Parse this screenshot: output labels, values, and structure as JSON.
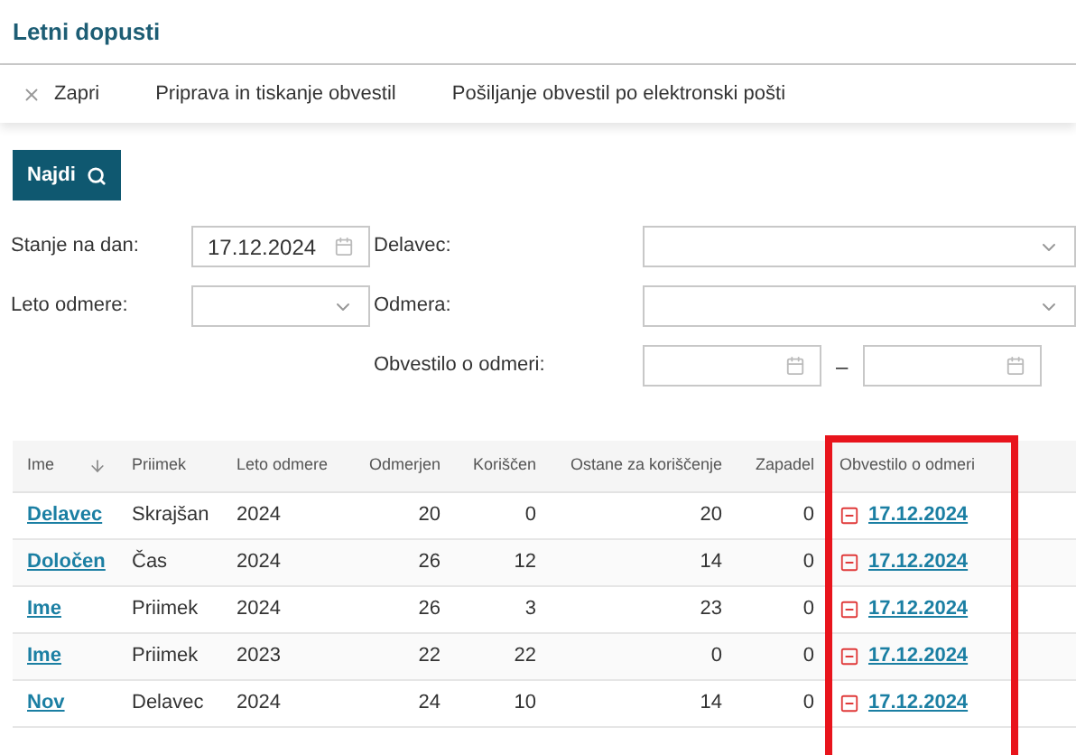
{
  "window": {
    "title": "Letni dopusti"
  },
  "toolbar": [
    {
      "kind": "close",
      "label": "Zapri"
    },
    {
      "kind": "text",
      "label": "Priprava in tiskanje obvestil"
    },
    {
      "kind": "text",
      "label": "Pošiljanje obvestil po elektronski pošti"
    }
  ],
  "search_button": {
    "label": "Najdi"
  },
  "filters_left": [
    {
      "label": "Stanje na dan:",
      "kind": "date",
      "value": "17.12.2024"
    },
    {
      "label": "Leto odmere:",
      "kind": "select"
    }
  ],
  "filters_right": [
    {
      "label": "Delavec:",
      "kind": "select"
    },
    {
      "label": "Odmera:",
      "kind": "select"
    },
    {
      "label": "Obvestilo o odmeri:",
      "kind": "date_range",
      "separator": "–"
    }
  ],
  "table": {
    "columns": [
      {
        "label": "Ime",
        "sorted": true
      },
      {
        "label": "Priimek",
        "sorted": false
      },
      {
        "label": "Leto odmere",
        "sorted": false
      },
      {
        "label": "Odmerjen",
        "sorted": false
      },
      {
        "label": "Koriščen",
        "sorted": false
      },
      {
        "label": "Ostane za koriščenje",
        "sorted": false
      },
      {
        "label": "Zapadel",
        "sorted": false
      },
      {
        "label": "Obvestilo o odmeri",
        "sorted": false,
        "highlighted": true
      }
    ],
    "rows": [
      {
        "cells": [
          "Delavec",
          "Skrajšan",
          "2024",
          "20",
          "0",
          "20",
          "0",
          "17.12.2024"
        ]
      },
      {
        "cells": [
          "Določen",
          "Čas",
          "2024",
          "26",
          "12",
          "14",
          "0",
          "17.12.2024"
        ]
      },
      {
        "cells": [
          "Ime",
          "Priimek",
          "2024",
          "26",
          "3",
          "23",
          "0",
          "17.12.2024"
        ]
      },
      {
        "cells": [
          "Ime",
          "Priimek",
          "2023",
          "22",
          "22",
          "0",
          "0",
          "17.12.2024"
        ]
      },
      {
        "cells": [
          "Nov",
          "Delavec",
          "2024",
          "24",
          "10",
          "14",
          "0",
          "17.12.2024"
        ]
      }
    ]
  }
}
